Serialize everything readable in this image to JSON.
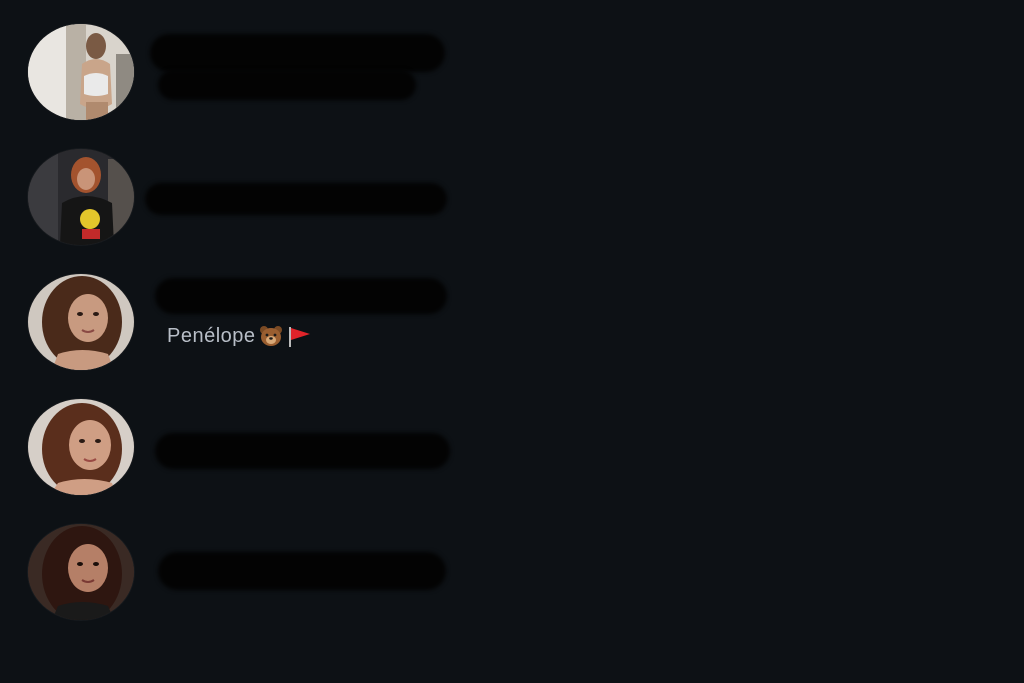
{
  "accounts": [
    {
      "username_fragment": "",
      "display_name": ""
    },
    {
      "username_fragment": "",
      "display_name": ""
    },
    {
      "username_fragment": "",
      "display_name": "Penélope"
    },
    {
      "username_fragment": "",
      "display_name": ""
    },
    {
      "username_fragment": "",
      "display_name": ""
    }
  ],
  "icons": {
    "bear": "bear-emoji",
    "flag": "red-flag-emoji"
  },
  "colors": {
    "background": "#0d1115",
    "display_name": "#b8bec7",
    "redaction": "#030303"
  }
}
